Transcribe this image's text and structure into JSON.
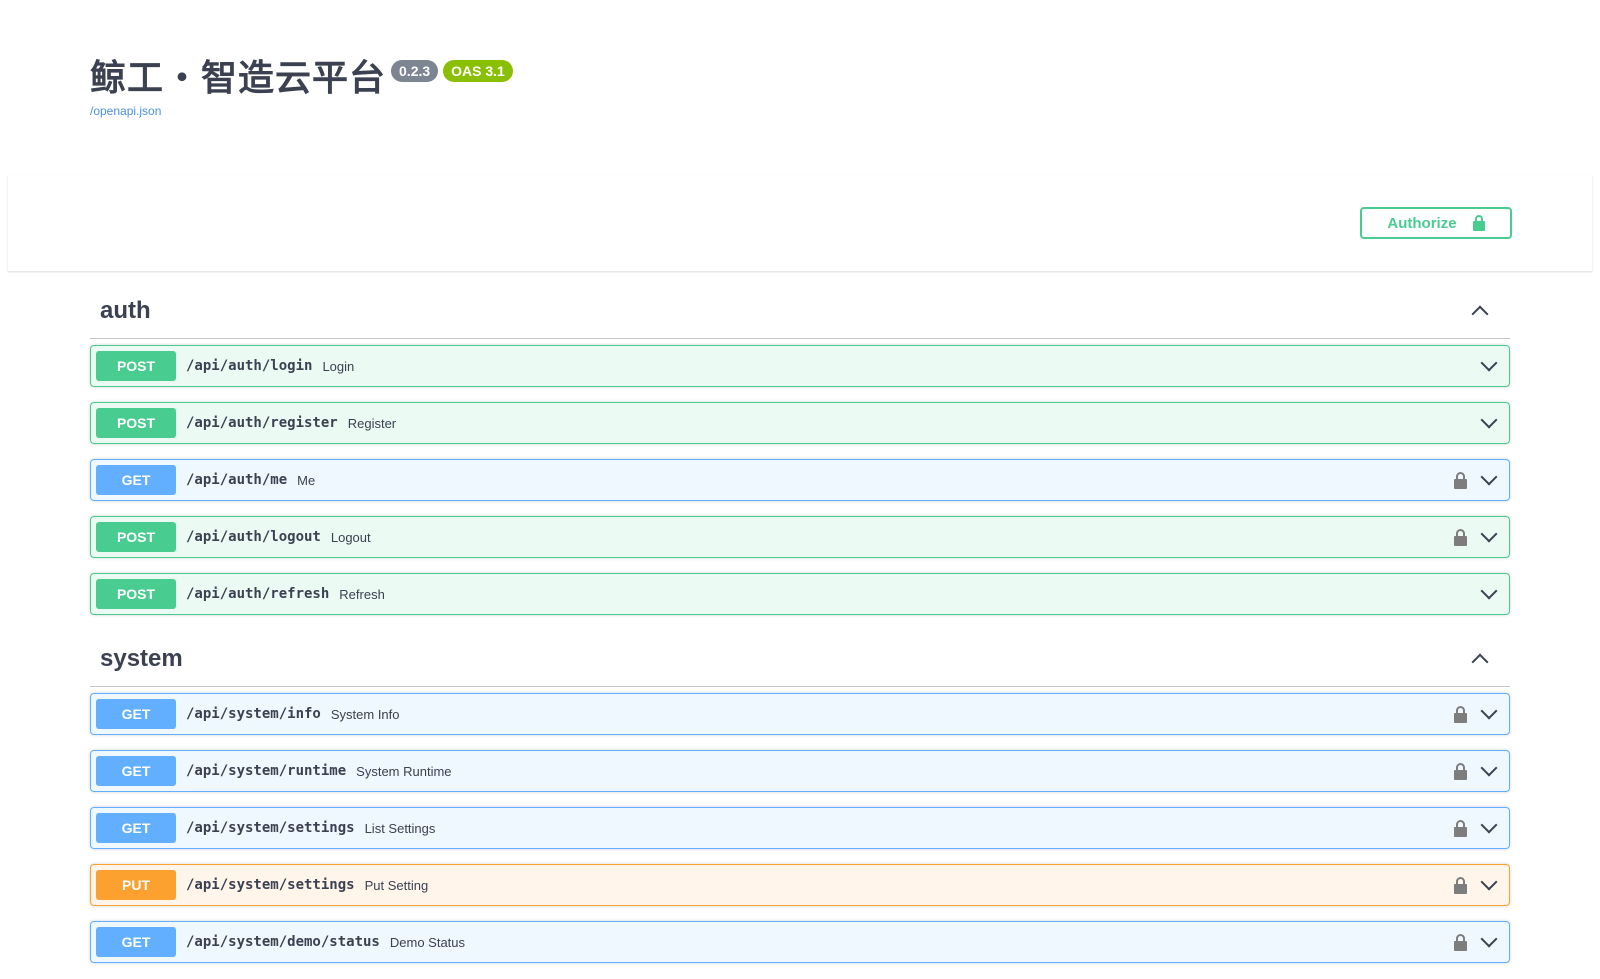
{
  "info": {
    "title": "鲸工・智造云平台",
    "version": "0.2.3",
    "oas": "OAS 3.1",
    "spec_link": "/openapi.json"
  },
  "authorize": {
    "label": "Authorize"
  },
  "colors": {
    "post": "#49cc90",
    "get": "#61affe",
    "put": "#fca130",
    "text": "#3b4151"
  },
  "sections": [
    {
      "name": "auth",
      "operations": [
        {
          "method": "POST",
          "path": "/api/auth/login",
          "summary": "Login",
          "locked": false
        },
        {
          "method": "POST",
          "path": "/api/auth/register",
          "summary": "Register",
          "locked": false
        },
        {
          "method": "GET",
          "path": "/api/auth/me",
          "summary": "Me",
          "locked": true
        },
        {
          "method": "POST",
          "path": "/api/auth/logout",
          "summary": "Logout",
          "locked": true
        },
        {
          "method": "POST",
          "path": "/api/auth/refresh",
          "summary": "Refresh",
          "locked": false
        }
      ]
    },
    {
      "name": "system",
      "operations": [
        {
          "method": "GET",
          "path": "/api/system/info",
          "summary": "System Info",
          "locked": true
        },
        {
          "method": "GET",
          "path": "/api/system/runtime",
          "summary": "System Runtime",
          "locked": true
        },
        {
          "method": "GET",
          "path": "/api/system/settings",
          "summary": "List Settings",
          "locked": true
        },
        {
          "method": "PUT",
          "path": "/api/system/settings",
          "summary": "Put Setting",
          "locked": true
        },
        {
          "method": "GET",
          "path": "/api/system/demo/status",
          "summary": "Demo Status",
          "locked": true
        }
      ]
    }
  ]
}
